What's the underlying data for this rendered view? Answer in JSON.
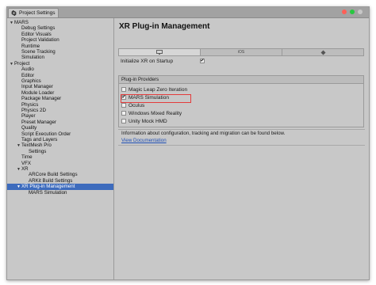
{
  "window": {
    "tab_label": "Project Settings",
    "controls": [
      "#ff5f57",
      "#28c840",
      "#c7c7c7"
    ]
  },
  "sidebar": {
    "items": [
      {
        "label": "MARS",
        "indent": 0,
        "arrow": "▼"
      },
      {
        "label": "Debug Settings",
        "indent": 1
      },
      {
        "label": "Editor Visuals",
        "indent": 1
      },
      {
        "label": "Project Validation",
        "indent": 1
      },
      {
        "label": "Runtime",
        "indent": 1
      },
      {
        "label": "Scene Tracking",
        "indent": 1
      },
      {
        "label": "Simulation",
        "indent": 1
      },
      {
        "label": "Project",
        "indent": 0,
        "arrow": "▼"
      },
      {
        "label": "Audio",
        "indent": 1
      },
      {
        "label": "Editor",
        "indent": 1
      },
      {
        "label": "Graphics",
        "indent": 1
      },
      {
        "label": "Input Manager",
        "indent": 1
      },
      {
        "label": "Module Loader",
        "indent": 1
      },
      {
        "label": "Package Manager",
        "indent": 1
      },
      {
        "label": "Physics",
        "indent": 1
      },
      {
        "label": "Physics 2D",
        "indent": 1
      },
      {
        "label": "Player",
        "indent": 1
      },
      {
        "label": "Preset Manager",
        "indent": 1
      },
      {
        "label": "Quality",
        "indent": 1
      },
      {
        "label": "Script Execution Order",
        "indent": 1
      },
      {
        "label": "Tags and Layers",
        "indent": 1
      },
      {
        "label": "TextMesh Pro",
        "indent": 1,
        "arrow": "▼"
      },
      {
        "label": "Settings",
        "indent": 2
      },
      {
        "label": "Time",
        "indent": 1
      },
      {
        "label": "VFX",
        "indent": 1
      },
      {
        "label": "XR",
        "indent": 1,
        "arrow": "▼"
      },
      {
        "label": "ARCore Build Settings",
        "indent": 2
      },
      {
        "label": "ARKit Build Settings",
        "indent": 2
      },
      {
        "label": "XR Plug-in Management",
        "indent": 1,
        "arrow": "▼",
        "selected": true
      },
      {
        "label": "MARS Simulation",
        "indent": 2
      }
    ]
  },
  "main": {
    "title": "XR Plug-in Management",
    "platform_tabs": [
      {
        "icon": "monitor-icon",
        "label": "",
        "active": true
      },
      {
        "icon": "ios-icon",
        "label": "iOS",
        "active": false
      },
      {
        "icon": "android-icon",
        "label": "",
        "active": false
      }
    ],
    "init_on_startup": {
      "label": "Initialize XR on Startup",
      "checked": true
    },
    "providers": {
      "header": "Plug-in Providers",
      "items": [
        {
          "label": "Magic Leap Zero Iteration",
          "checked": false
        },
        {
          "label": "MARS Simulation",
          "checked": true
        },
        {
          "label": "Oculus",
          "checked": false
        },
        {
          "label": "Windows Mixed Reality",
          "checked": false
        },
        {
          "label": "Unity Mock HMD",
          "checked": false
        }
      ]
    },
    "info_text": "Information about configuration, tracking and migration can be found below.",
    "doc_link": "View Documentation"
  },
  "colors": {
    "selection": "#3d6bbd",
    "highlight": "#e33b3b",
    "link": "#1f4fb5"
  }
}
